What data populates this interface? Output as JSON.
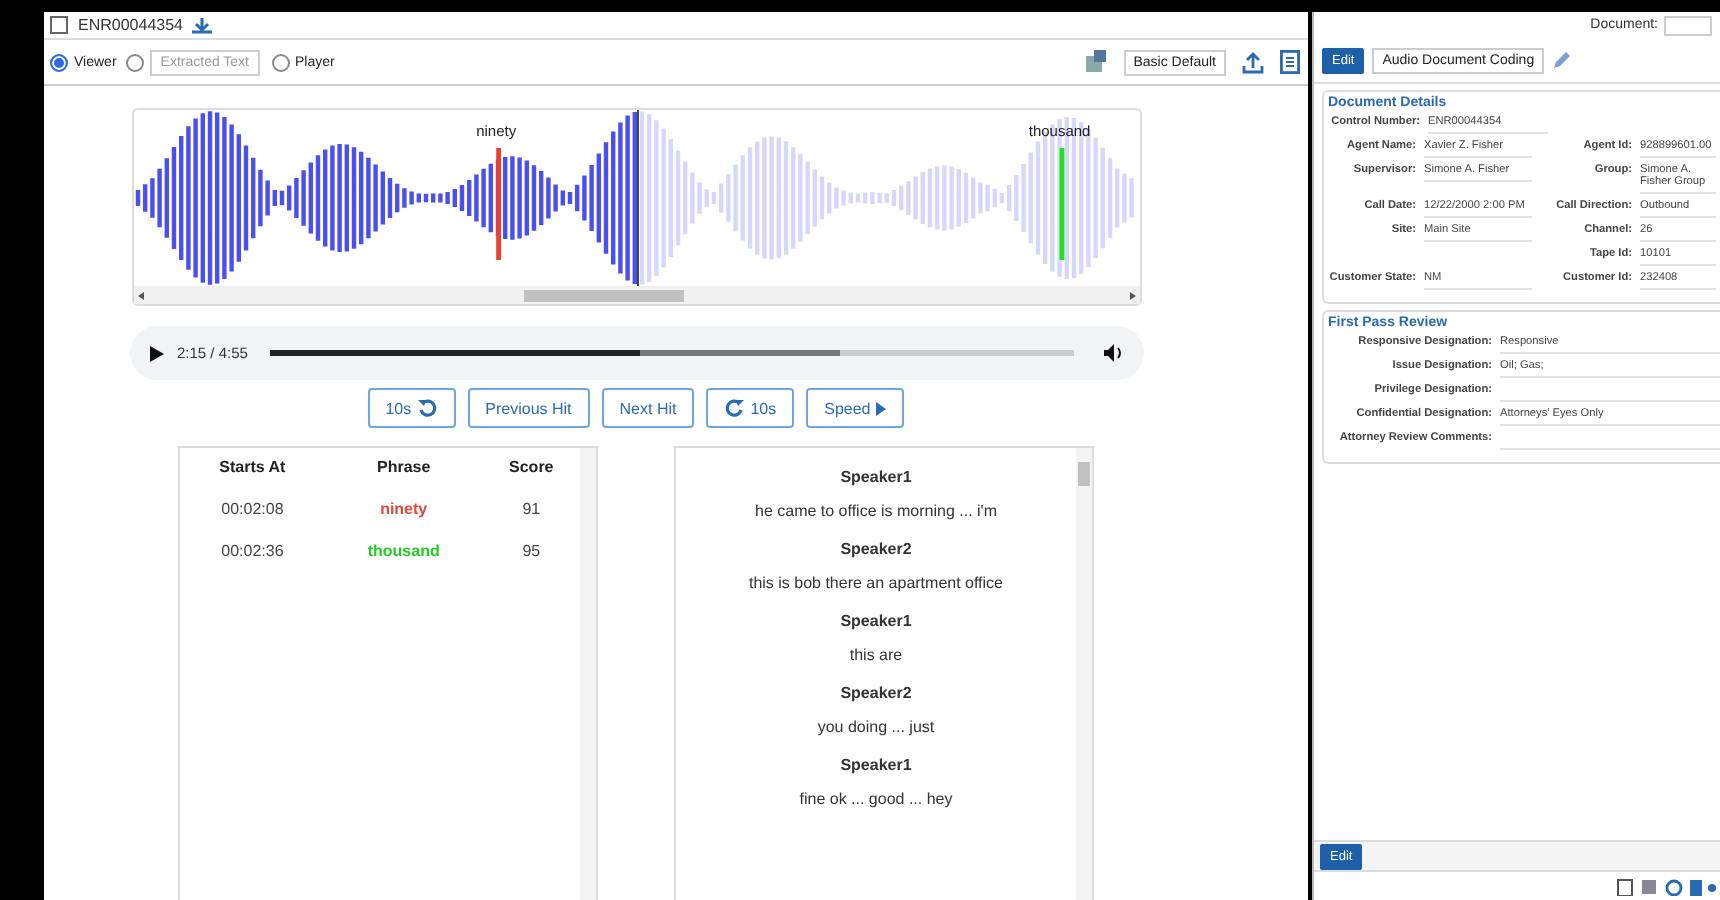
{
  "doc_header": {
    "checked": false,
    "control_number": "ENR00044354",
    "document_label": "Document:"
  },
  "view_modes": [
    {
      "label": "Viewer",
      "selected": true
    },
    {
      "selected": false,
      "dropdown": "Extracted Text"
    },
    {
      "label": "Player",
      "selected": false
    }
  ],
  "viewer_toolbar": {
    "layout": "Basic Default"
  },
  "waveform": {
    "played": {
      "level": 0.5
    },
    "markers": [
      {
        "label": "ninety",
        "color": "#f04030"
      },
      {
        "label": "thousand",
        "color": "#20e020"
      }
    ]
  },
  "player": {
    "time": "2:15 / 4:55",
    "progress": {
      "level": 0.46
    },
    "buffered": {
      "level": 0.71
    }
  },
  "controls": [
    {
      "label": "10s",
      "kind": "back"
    },
    {
      "label": "Previous Hit",
      "kind": "text"
    },
    {
      "label": "Next Hit",
      "kind": "text"
    },
    {
      "label": "10s",
      "kind": "forward"
    },
    {
      "label": "Speed",
      "kind": "menu"
    }
  ],
  "hits": {
    "columns": [
      "Starts At",
      "Phrase",
      "Score"
    ],
    "rows": [
      {
        "starts_at": "00:02:08",
        "phrase": "ninety",
        "color": "#e04a3a",
        "score": "91"
      },
      {
        "starts_at": "00:02:36",
        "phrase": "thousand",
        "color": "#22cc22",
        "score": "95"
      }
    ]
  },
  "transcript": [
    {
      "speaker": "Speaker1",
      "text": "he came to office is morning ... i'm"
    },
    {
      "speaker": "Speaker2",
      "text": "this is bob there an apartment office"
    },
    {
      "speaker": "Speaker1",
      "text": "this are"
    },
    {
      "speaker": "Speaker2",
      "text": "you doing ... just"
    },
    {
      "speaker": "Speaker1",
      "text": "fine ok ... good ... hey"
    }
  ],
  "coding": {
    "edit": "Edit",
    "layout": "Audio Document Coding",
    "sections": [
      {
        "title": "Document Details",
        "rows": [
          [
            {
              "label": "Control Number:",
              "value": "ENR00044354"
            }
          ],
          [
            {
              "label": "Agent Name:",
              "value": "Xavier Z. Fisher"
            },
            {
              "label": "Agent Id:",
              "value": "928899601.00"
            }
          ],
          [
            {
              "label": "Supervisor:",
              "value": "Simone A. Fisher"
            },
            {
              "label": "Group:",
              "value": "Simone A. Fisher Group"
            }
          ],
          [
            {
              "label": "Call Date:",
              "value": "12/22/2000 2:00 PM"
            },
            {
              "label": "Call Direction:",
              "value": "Outbound"
            }
          ],
          [
            {
              "label": "Site:",
              "value": "Main Site"
            },
            {
              "label": "Channel:",
              "value": "26"
            }
          ],
          [
            {},
            {
              "label": "Tape Id:",
              "value": "10101"
            }
          ],
          [
            {
              "label": "Customer State:",
              "value": "NM"
            },
            {
              "label": "Customer Id:",
              "value": "232408"
            }
          ]
        ]
      },
      {
        "title": "First Pass Review",
        "rows": [
          [
            {
              "label": "Responsive Designation:",
              "value": "Responsive"
            }
          ],
          [
            {
              "label": "Issue Designation:",
              "value": "Oil; Gas;"
            }
          ],
          [
            {
              "label": "Privilege Designation:"
            }
          ],
          [
            {
              "label": "Confidential Designation:",
              "value": "Attorneys' Eyes Only"
            }
          ],
          [
            {
              "label": "Attorney Review Comments:"
            }
          ]
        ]
      }
    ],
    "footer_edit": "Edit"
  }
}
